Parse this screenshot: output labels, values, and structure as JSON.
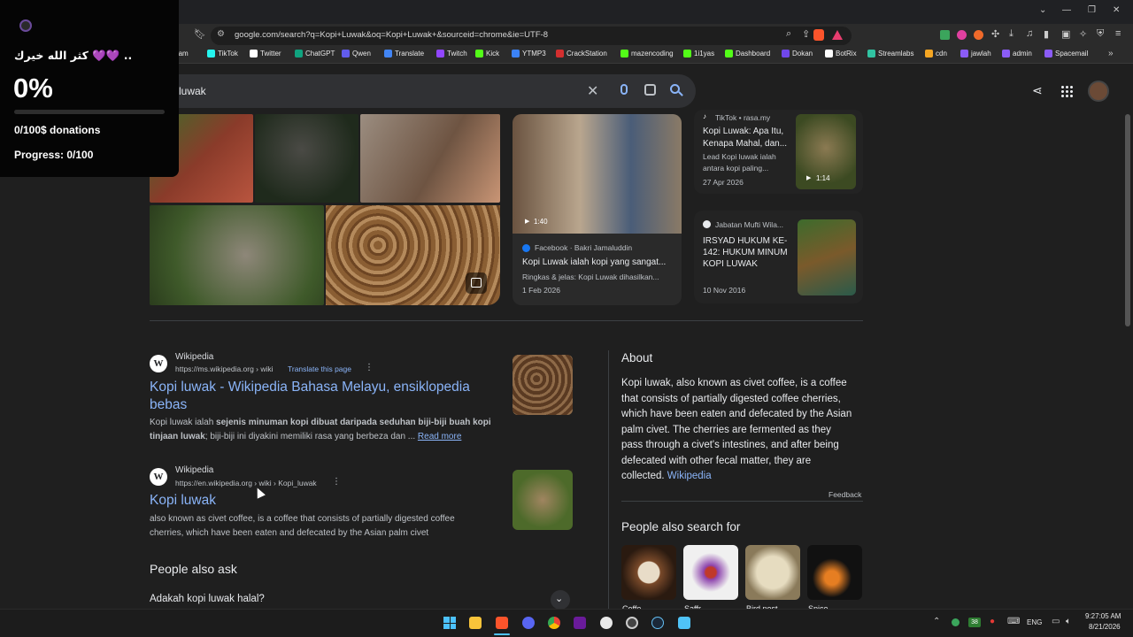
{
  "overlay": {
    "arabic_text": "كثر الله خيرك 💜💜 ..",
    "percent": "0%",
    "progress_fraction": 0.0,
    "donations": "0/100$ donations",
    "progress": "Progress: 0/100"
  },
  "browser": {
    "url": "google.com/search?q=Kopi+Luwak&oq=Kopi+Luwak+&sourceid=chrome&ie=UTF-8",
    "bookmarks": [
      {
        "label": "agram",
        "color": "#c13584"
      },
      {
        "label": "TikTok",
        "color": "#25f4ee"
      },
      {
        "label": "Twitter",
        "color": "#ffffff"
      },
      {
        "label": "ChatGPT",
        "color": "#10a37f"
      },
      {
        "label": "Qwen",
        "color": "#615ced"
      },
      {
        "label": "Translate",
        "color": "#4285f4"
      },
      {
        "label": "Twitch",
        "color": "#9146ff"
      },
      {
        "label": "Kick",
        "color": "#53fc18"
      },
      {
        "label": "YTMP3",
        "color": "#3b82f6"
      },
      {
        "label": "CrackStation",
        "color": "#d32f2f"
      },
      {
        "label": "mazencoding",
        "color": "#53fc18"
      },
      {
        "label": "1i1yas",
        "color": "#53fc18"
      },
      {
        "label": "Dashboard",
        "color": "#53fc18"
      },
      {
        "label": "Dokan",
        "color": "#7047eb"
      },
      {
        "label": "BotRix",
        "color": "#ffffff"
      },
      {
        "label": "Streamlabs",
        "color": "#31c3a2"
      },
      {
        "label": "cdn",
        "color": "#f5a623"
      },
      {
        "label": "jawlah",
        "color": "#8b5cf6"
      },
      {
        "label": "admin",
        "color": "#8b5cf6"
      },
      {
        "label": "Spacemail",
        "color": "#8b5cf6"
      }
    ],
    "more_bookmarks": "»"
  },
  "search": {
    "query": "luwak"
  },
  "videos": [
    {
      "duration": "1:40",
      "source": "Facebook · Bakri Jamaluddin",
      "title": "Kopi Luwak ialah kopi yang sangat...",
      "desc": "Ringkas & jelas: Kopi Luwak dihasilkan...",
      "date": "1 Feb 2026"
    },
    {
      "duration": "1:14",
      "source": "TikTok • rasa.my",
      "title_lines": [
        "Kopi Luwak: Apa Itu,",
        "Kenapa Mahal, dan..."
      ],
      "desc_lines": [
        "Lead Kopi luwak ialah",
        "antara kopi paling..."
      ],
      "date": "27 Apr 2026"
    },
    {
      "source": "Jabatan Mufti Wila...",
      "title_lines": [
        "IRSYAD HUKUM KE-",
        "142: HUKUM MINUM",
        "KOPI LUWAK"
      ],
      "date": "10 Nov 2016"
    }
  ],
  "results": [
    {
      "site": "Wikipedia",
      "url": "https://ms.wikipedia.org › wiki",
      "translate": "Translate this page",
      "title_lines": [
        "Kopi luwak - Wikipedia Bahasa Melayu, ensiklopedia",
        "bebas"
      ],
      "snippet_pre": "Kopi luwak ialah ",
      "snippet_bold_1": "sejenis minuman kopi dibuat daripada seduhan biji-biji buah kopi",
      "snippet_bold_2": "tinjaan luwak",
      "snippet_post": "; biji-biji ini diyakini memiliki rasa yang berbeza dan ...",
      "read_more": "Read more"
    },
    {
      "site": "Wikipedia",
      "url": "https://en.wikipedia.org › wiki › Kopi_luwak",
      "title": "Kopi luwak",
      "snippet_lines": [
        "also known as civet coffee, is a coffee that consists of partially digested coffee",
        "cherries, which have been eaten and defecated by the Asian palm civet"
      ]
    }
  ],
  "people_also_ask": {
    "heading": "People also ask",
    "question": "Adakah kopi luwak halal?"
  },
  "knowledge_panel": {
    "heading": "About",
    "text_lines": [
      "Kopi luwak, also known as civet coffee, is a coffee",
      "that consists of partially digested coffee cherries,",
      "which have been eaten and defecated by the Asian",
      "palm civet. The cherries are fermented as they",
      "pass through a civet's intestines, and after being",
      "defecated with other fecal matter, they are"
    ],
    "last_line": "collected. ",
    "source_link": "Wikipedia",
    "feedback": "Feedback",
    "pasf_heading": "People also search for",
    "pasf_labels": [
      "Coffe...",
      "Saffr...",
      "Bird nest",
      "Spice"
    ]
  },
  "taskbar": {
    "lang": "ENG",
    "time": "9:27:05 AM",
    "date": "8/21/2026",
    "badge": "38"
  }
}
